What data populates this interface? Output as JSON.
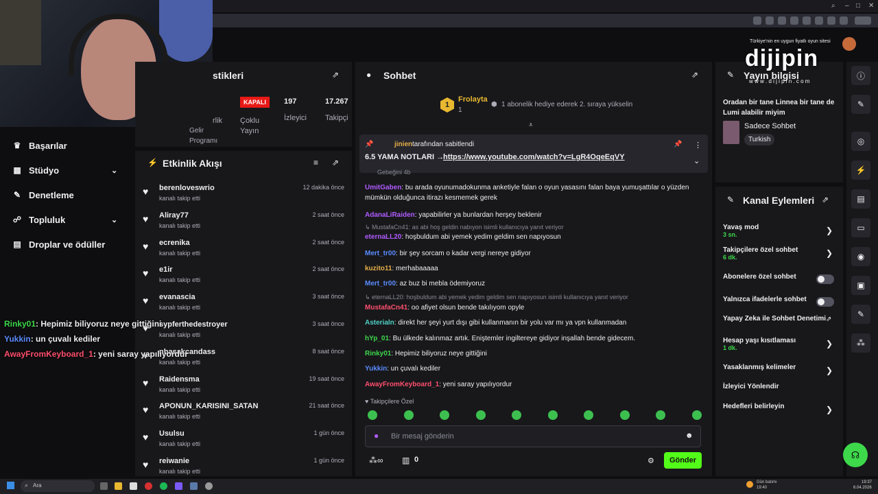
{
  "browser": {
    "address": "",
    "window_min": "–",
    "window_max": "□",
    "window_close": "✕"
  },
  "sidebar": {
    "items": [
      {
        "label": "Başarılar",
        "icon": "trophy-icon"
      },
      {
        "label": "Stüdyo",
        "icon": "studio-icon"
      },
      {
        "label": "Denetleme",
        "icon": "wrench-icon"
      },
      {
        "label": "Topluluk",
        "icon": "community-icon"
      },
      {
        "label": "Droplar ve ödüller",
        "icon": "gift-icon"
      }
    ]
  },
  "overlay_chat": [
    {
      "user": "Rinky01",
      "text": ": Hepimiz biliyoruz neye gittiğini",
      "color": "#3dd94b"
    },
    {
      "user": "Yukkin",
      "text": ": un çuvalı kediler",
      "color": "#5b8cff"
    },
    {
      "user": "AwayFromKeyboard_1",
      "text": ": yeni saray yapılıyordur",
      "color": "#ff4f6d"
    }
  ],
  "stats": {
    "title": "stikleri",
    "partial_label_1": "rlik",
    "partial_label_2": "Gelir",
    "partial_label_3": "Programı",
    "multi_badge": "KAPALI",
    "multi_label_1": "Çoklu",
    "multi_label_2": "Yayın",
    "viewers_value": "197",
    "viewers_label": "İzleyici",
    "followers_value": "17.267",
    "followers_label": "Takipçi"
  },
  "activity": {
    "title": "Etkinlik Akışı",
    "subtitle": "kanalı takip etti",
    "items": [
      {
        "name": "berenloveswrio",
        "time": "12 dakika önce"
      },
      {
        "name": "Aliray77",
        "time": "2 saat önce"
      },
      {
        "name": "ecrenika",
        "time": "2 saat önce"
      },
      {
        "name": "e1ir",
        "time": "2 saat önce"
      },
      {
        "name": "evanascia",
        "time": "3 saat önce"
      },
      {
        "name": "sypferthedestroyer",
        "time": "3 saat önce"
      },
      {
        "name": "nbasakcandass",
        "time": "8 saat önce"
      },
      {
        "name": "Raidensma",
        "time": "19 saat önce"
      },
      {
        "name": "APONUN_KARISINI_SATAN",
        "time": "21 saat önce"
      },
      {
        "name": "Usulsu",
        "time": "1 gün önce"
      },
      {
        "name": "reiwanie",
        "time": "1 gün önce"
      }
    ]
  },
  "chat": {
    "title": "Sohbet",
    "leader_name": "Frolayta",
    "leader_rank": "1",
    "leader_count": "1",
    "leader_sub": "1 abonelik hediye ederek 2. sıraya yükselin",
    "pinned_by": "jinien",
    "pinned_label": "tarafından sabitlendi",
    "pinned_title": "6.5 YAMA NOTLARI →",
    "pinned_link": "https://www.youtube.com/watch?v=LgR4OqeEqVY",
    "cut_line": "Gebeğini 4b",
    "messages": [
      {
        "user": "UmitGaben",
        "text": ": bu arada oyunumadokunma anketiyle falan o oyun yasasını falan baya yumuşattılar o yüzden mümkün olduğunca itirazı kesmemek gerek",
        "color": "#b05bff"
      },
      {
        "user": "AdanaLiRaiden",
        "text": ": yapabilirler ya bunlardan herşey beklenir",
        "color": "#b05bff"
      },
      {
        "reply": "MustafaCn41: as abi hoş geldin nabıyon isimli kullanıcıya yanıt veriyor"
      },
      {
        "user": "eternaLL20",
        "text": ": hoşbuldum abi yemek yedim geldim sen napıyosun",
        "color": "#b05bff"
      },
      {
        "user": "Mert_tr00",
        "text": ": bir şey sorcam o kadar vergi nereye gidiyor",
        "color": "#5b8cff"
      },
      {
        "user": "kuzito11",
        "text": ": merhabaaaaa",
        "color": "#e8b04a"
      },
      {
        "user": "Mert_tr00",
        "text": ": az buz bi mebla ödemiyoruz",
        "color": "#5b8cff"
      },
      {
        "reply": "eternaLL20: hoşbuldum abi yemek yedim geldim sen napıyosun isimli kullanıcıya yanıt veriyor"
      },
      {
        "user": "MustafaCn41",
        "text": ": oo afiyet olsun bende takılıyom opyle",
        "color": "#ff4f6d"
      },
      {
        "user": "Asterialn",
        "text": ": direkt her şeyi yurt dışı gibi kullanmanın bir yolu var mı ya vpn kullanmadan",
        "color": "#4fd1c5"
      },
      {
        "user": "hYp_01",
        "text": ": Bu ülkede kalınmaz artık. Eniştemler ingiltereye gidiyor inşallah bende gidecem.",
        "color": "#3dd94b"
      },
      {
        "user": "Rinky01",
        "text": ": Hepimiz biliyoruz neye gittiğini",
        "color": "#3dd94b"
      },
      {
        "user": "Yukkin",
        "text": ": un çuvalı kediler",
        "color": "#5b8cff"
      },
      {
        "user": "AwayFromKeyboard_1",
        "text": ": yeni saray yapılıyordur",
        "color": "#ff4f6d"
      }
    ],
    "followers_only": "Takipçilere Özel",
    "input_placeholder": "Bir mesaj gönderin",
    "points": "0",
    "send": "Gönder"
  },
  "stream_info": {
    "title": "Yayın bilgisi",
    "stream_title": "Oradan bir tane Linnea bir tane de Lumi alabilir miyim",
    "category": "Sadece Sohbet",
    "tag": "Turkish"
  },
  "sponsor": {
    "tagline": "Türkiye'nin en uygun fiyatlı oyun sitesi",
    "brand": "dijipin",
    "url": "w w w . d i j i p i n . c o m"
  },
  "channel_actions": {
    "title": "Kanal Eylemleri",
    "items": [
      {
        "label": "Yavaş mod",
        "sub": "3 sn."
      },
      {
        "label": "Takipçilere özel sohbet",
        "sub": "6 dk."
      },
      {
        "label": "Abonelere özel sohbet",
        "sub": ""
      },
      {
        "label": "Yalnızca ifadelerle sohbet",
        "sub": ""
      },
      {
        "label": "Yapay Zeka ile Sohbet Denetimi",
        "sub": ""
      },
      {
        "label": "Hesap yaşı kısıtlaması",
        "sub": "1 dk."
      },
      {
        "label": "Yasaklanmış kelimeler",
        "sub": ""
      },
      {
        "label": "İzleyici Yönlendir",
        "sub": ""
      },
      {
        "label": "Hedefleri belirleyin",
        "sub": ""
      }
    ]
  },
  "taskbar": {
    "search": "Ara",
    "weather_label": "Gün batımı",
    "weather_time": "19:40",
    "clock_time": "19:37",
    "clock_date": "6.04.2026"
  },
  "colors": {
    "accent": "#53fc18",
    "panel": "#18181b",
    "background": "#0e0e10"
  }
}
